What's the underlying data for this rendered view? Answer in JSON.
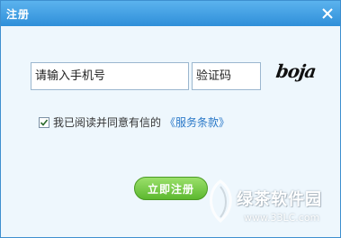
{
  "window": {
    "title": "注册"
  },
  "form": {
    "phone_placeholder": "请输入手机号",
    "code_placeholder": "验证码",
    "captcha_text": "boja",
    "agree_checked": true,
    "agree_text": "我已阅读并同意有信的",
    "terms_link": "《服务条款》",
    "submit_label": "立即注册"
  },
  "watermark": {
    "name": "绿茶软件园",
    "url": "www.33LC.com"
  },
  "colors": {
    "titlebar": "#2f8fd9",
    "background": "#eef7fd",
    "submit": "#5cb82f",
    "link": "#2a78c8"
  },
  "icons": {
    "close": "close-icon",
    "check": "check-icon",
    "watermark": "leaf-logo-icon"
  }
}
